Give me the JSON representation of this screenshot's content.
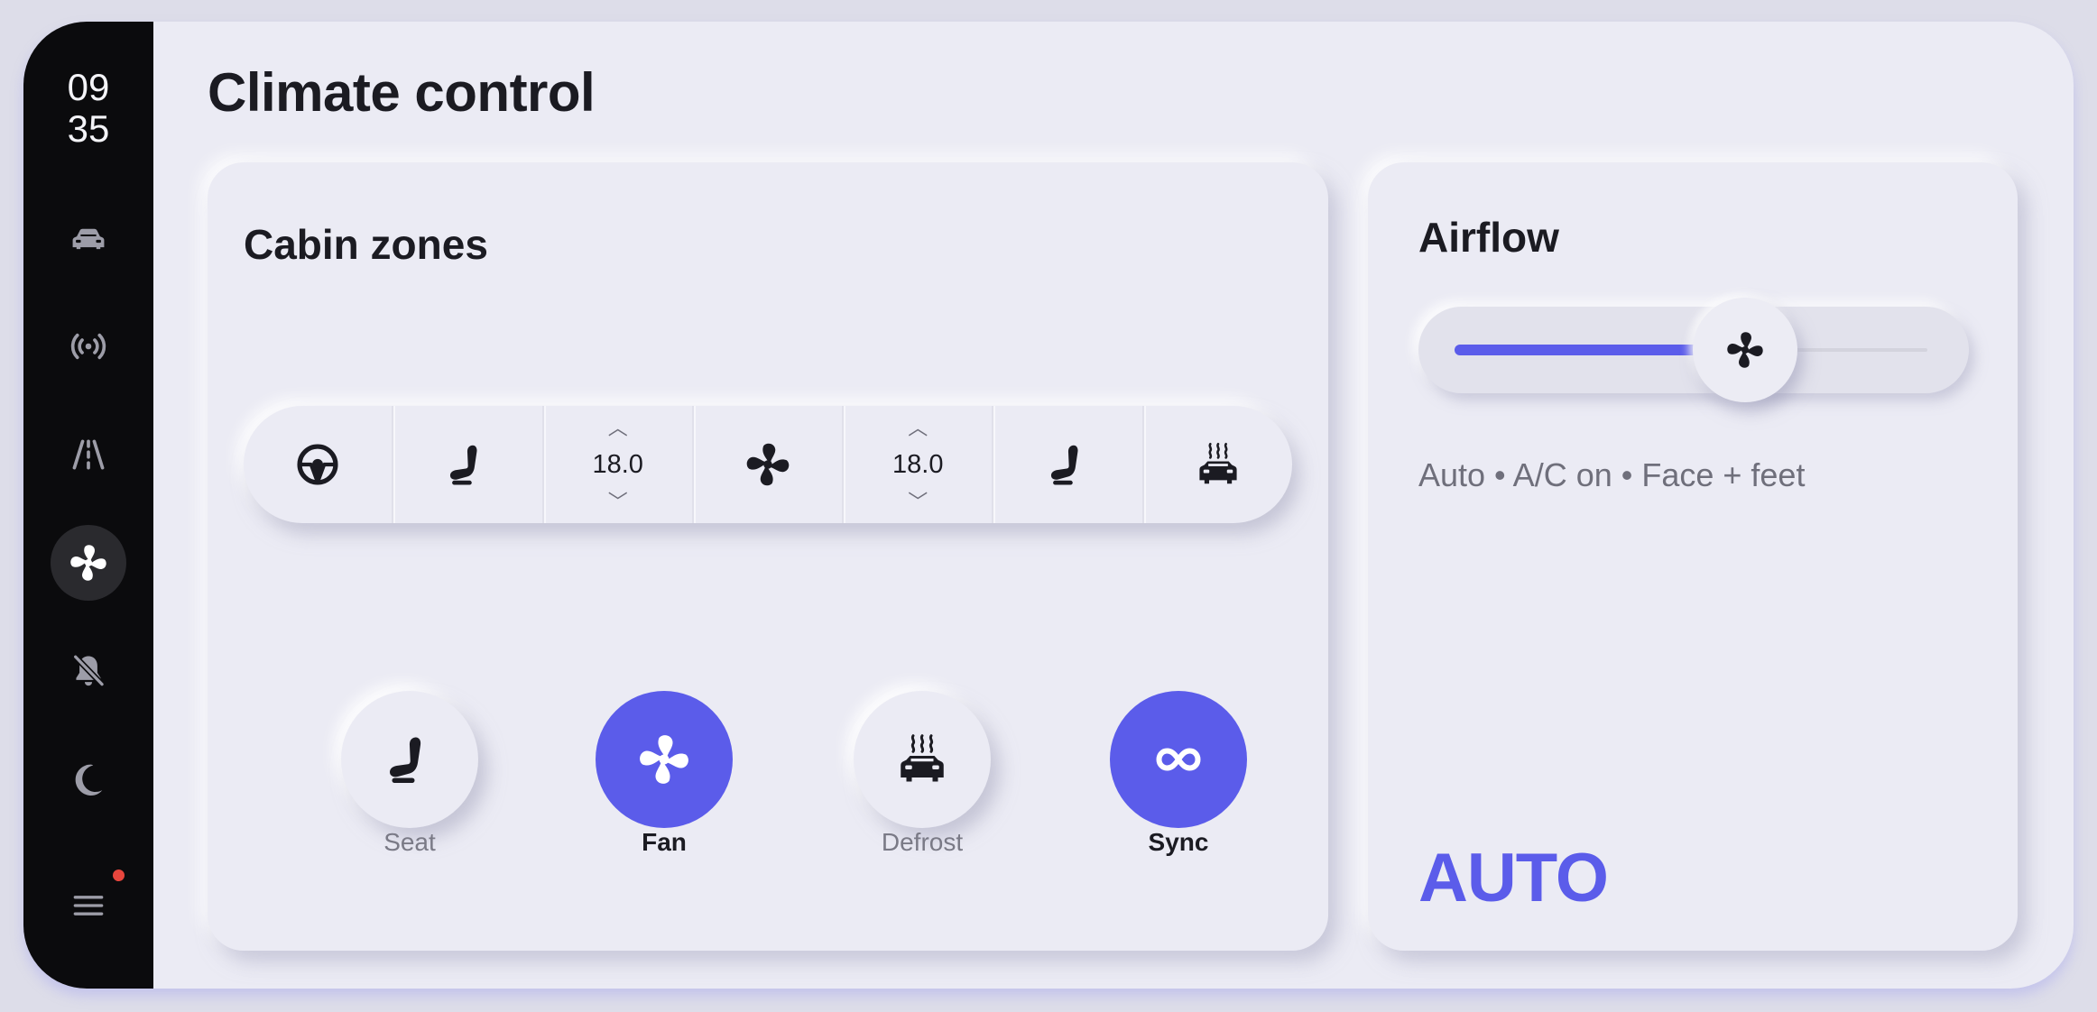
{
  "clock": {
    "hour": "09",
    "minute": "35"
  },
  "nav": [
    {
      "icon": "car-icon"
    },
    {
      "icon": "radio-icon"
    },
    {
      "icon": "road-icon"
    },
    {
      "icon": "fan-icon",
      "active": true
    },
    {
      "icon": "bell-off-icon"
    },
    {
      "icon": "moon-icon"
    },
    {
      "icon": "menu-icon",
      "notification": true
    }
  ],
  "page": {
    "title": "Climate control"
  },
  "cabin": {
    "title": "Cabin zones",
    "strip": {
      "segments": [
        "steering-wheel-icon",
        "seat-icon",
        "temp-left",
        "fan-icon",
        "temp-right",
        "seat-icon",
        "defrost-icon"
      ],
      "temp_left": "18.0",
      "temp_right": "18.0"
    },
    "features": [
      {
        "label": "Seat",
        "icon": "seat-icon",
        "active": false
      },
      {
        "label": "Fan",
        "icon": "fan-icon",
        "active": true
      },
      {
        "label": "Defrost",
        "icon": "defrost-icon",
        "active": false
      },
      {
        "label": "Sync",
        "icon": "infinity-icon",
        "active": true
      }
    ]
  },
  "airflow": {
    "title": "Airflow",
    "level": 0.52,
    "status": "Auto • A/C on • Face + feet",
    "mode": "AUTO"
  },
  "colors": {
    "accent": "#5b5cea",
    "sidebar": "#0b0b0d",
    "surface": "#ebebf4",
    "notification": "#e8463d"
  }
}
